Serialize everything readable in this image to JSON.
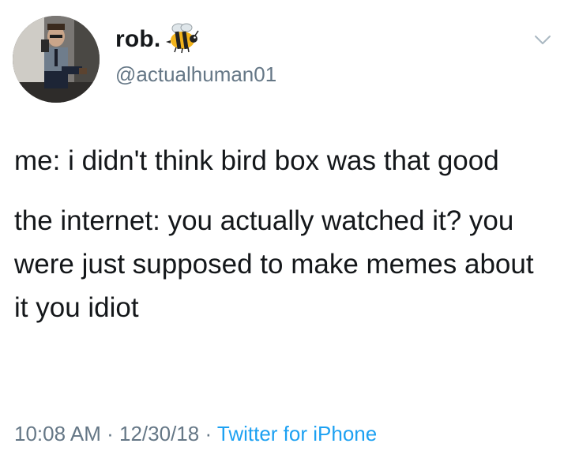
{
  "user": {
    "display_name": "rob.",
    "handle": "@actualhuman01",
    "name_emoji": "bee-icon"
  },
  "tweet": {
    "paragraphs": [
      "me: i didn't think bird box was that good",
      "the internet: you actually watched it? you were just supposed to make memes about it you idiot"
    ],
    "time": "10:08 AM",
    "separator": "·",
    "date": "12/30/18",
    "source": "Twitter for iPhone"
  },
  "colors": {
    "text": "#14171a",
    "secondary": "#657786",
    "link": "#1da1f2"
  }
}
